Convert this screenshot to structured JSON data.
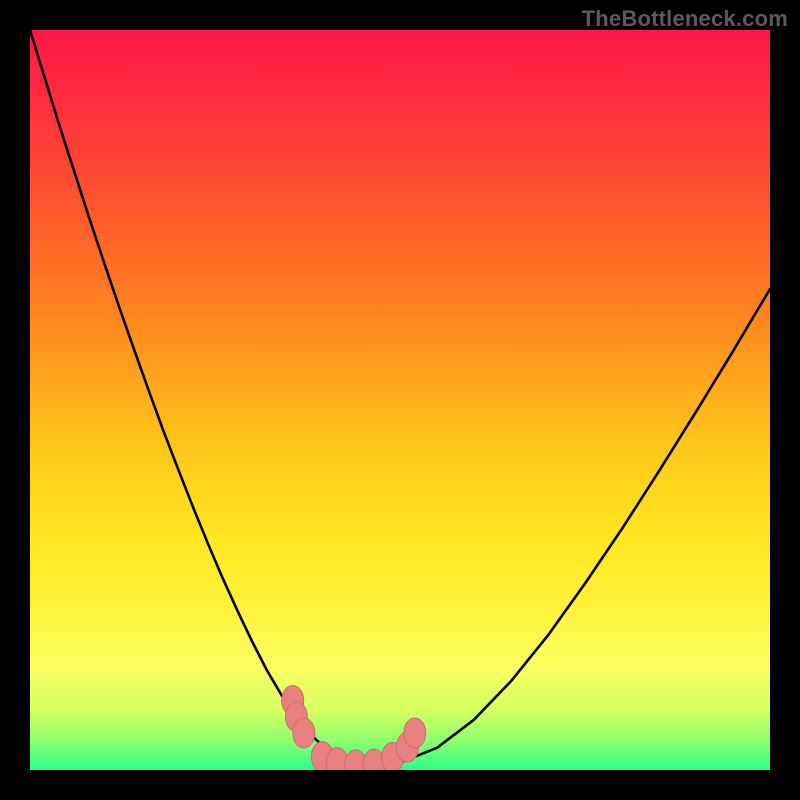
{
  "watermark": "TheBottleneck.com",
  "colors": {
    "frame": "#000000",
    "curve": "#000000",
    "marker_fill": "#e98080",
    "marker_stroke": "#cc6c6c",
    "gradient_stops": [
      {
        "offset": 0.0,
        "color": "#ff1846"
      },
      {
        "offset": 0.1,
        "color": "#ff2e3e"
      },
      {
        "offset": 0.25,
        "color": "#ff5a2a"
      },
      {
        "offset": 0.4,
        "color": "#ff8a1f"
      },
      {
        "offset": 0.55,
        "color": "#ffc21a"
      },
      {
        "offset": 0.68,
        "color": "#ffe61f"
      },
      {
        "offset": 0.78,
        "color": "#fff23a"
      },
      {
        "offset": 0.86,
        "color": "#fcff60"
      },
      {
        "offset": 0.92,
        "color": "#d4ff60"
      },
      {
        "offset": 0.96,
        "color": "#8dff70"
      },
      {
        "offset": 1.0,
        "color": "#2bff86"
      }
    ]
  },
  "chart_data": {
    "type": "line",
    "title": "",
    "xlabel": "",
    "ylabel": "",
    "x": [
      0.0,
      0.02,
      0.04,
      0.06,
      0.08,
      0.1,
      0.12,
      0.14,
      0.16,
      0.18,
      0.2,
      0.22,
      0.24,
      0.26,
      0.28,
      0.3,
      0.32,
      0.34,
      0.36,
      0.38,
      0.4,
      0.42,
      0.44,
      0.46,
      0.48,
      0.5,
      0.55,
      0.6,
      0.65,
      0.7,
      0.75,
      0.8,
      0.85,
      0.9,
      0.95,
      1.0
    ],
    "series": [
      {
        "name": "bottleneck-curve",
        "y": [
          1.0,
          0.935,
          0.87,
          0.808,
          0.746,
          0.686,
          0.627,
          0.57,
          0.514,
          0.459,
          0.407,
          0.356,
          0.307,
          0.26,
          0.216,
          0.174,
          0.135,
          0.101,
          0.071,
          0.047,
          0.029,
          0.017,
          0.01,
          0.007,
          0.007,
          0.01,
          0.03,
          0.068,
          0.12,
          0.182,
          0.252,
          0.326,
          0.404,
          0.484,
          0.566,
          0.65
        ]
      }
    ],
    "xlim": [
      0,
      1
    ],
    "ylim": [
      0,
      1
    ],
    "markers": [
      {
        "x": 0.355,
        "y": 0.094
      },
      {
        "x": 0.36,
        "y": 0.072
      },
      {
        "x": 0.37,
        "y": 0.05
      },
      {
        "x": 0.395,
        "y": 0.018
      },
      {
        "x": 0.415,
        "y": 0.01
      },
      {
        "x": 0.44,
        "y": 0.007
      },
      {
        "x": 0.465,
        "y": 0.008
      },
      {
        "x": 0.49,
        "y": 0.017
      },
      {
        "x": 0.51,
        "y": 0.031
      },
      {
        "x": 0.52,
        "y": 0.05
      }
    ],
    "annotations": []
  }
}
